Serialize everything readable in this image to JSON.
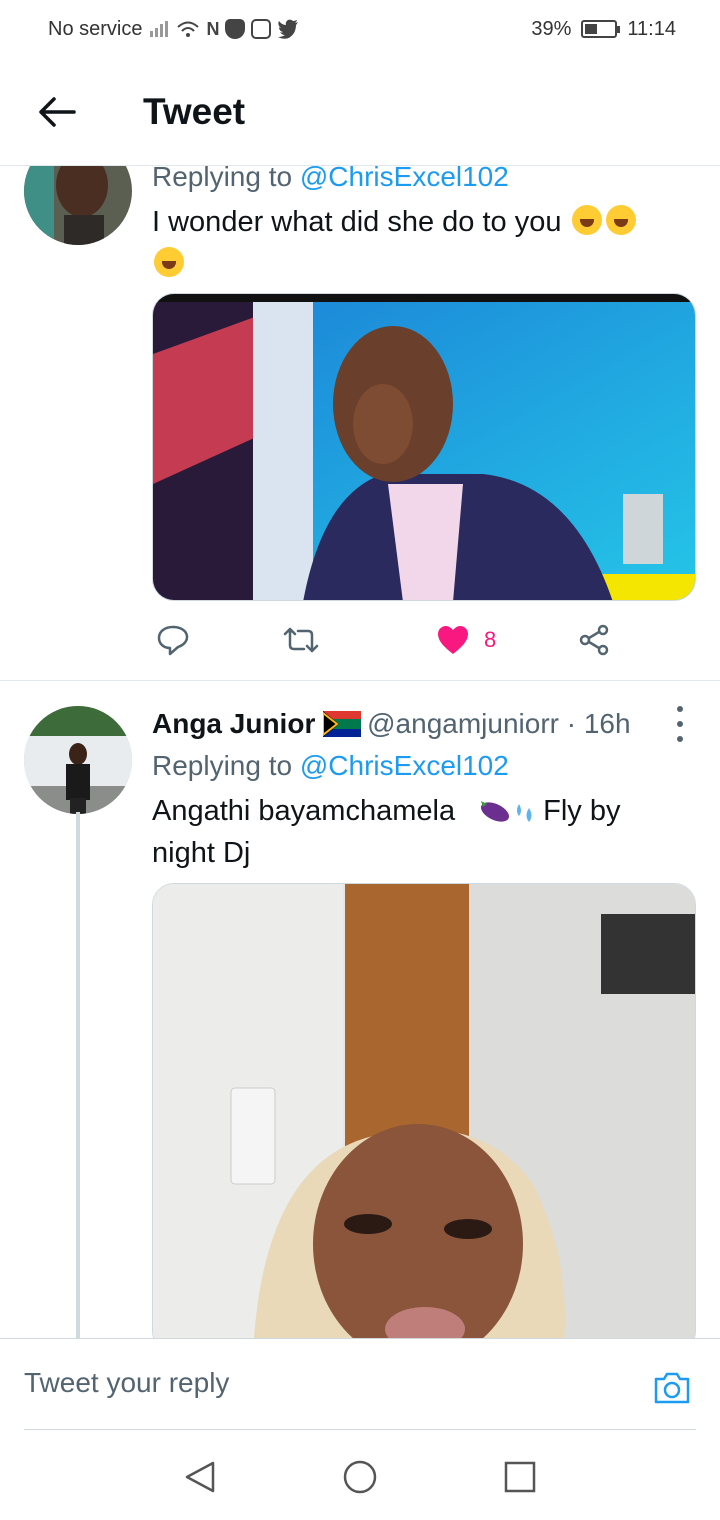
{
  "status": {
    "carrier": "No service",
    "battery": "39%",
    "time": "11:14"
  },
  "header": {
    "title": "Tweet"
  },
  "tweet1": {
    "replying_prefix": "Replying to ",
    "replying_handle": "@ChrisExcel102",
    "text": "I wonder what did she do to you",
    "like_count": "8"
  },
  "tweet2": {
    "display_name": "Anga Junior",
    "handle": "@angamjuniorr",
    "separator": " · ",
    "time": "16h",
    "replying_prefix": "Replying to ",
    "replying_handle": "@ChrisExcel102",
    "text_part1": "Angathi bayamchamela",
    "text_part2": "Fly by",
    "text_part3": "night Dj"
  },
  "composer": {
    "placeholder": "Tweet your reply"
  },
  "colors": {
    "accent": "#1d9bf0",
    "like": "#f91880",
    "text": "#0f1419",
    "muted": "#536471"
  },
  "icons": [
    "back-arrow-icon",
    "reply-icon",
    "retweet-icon",
    "heart-icon",
    "share-icon",
    "more-icon",
    "camera-icon",
    "nav-back-icon",
    "nav-home-icon",
    "nav-recents-icon"
  ]
}
